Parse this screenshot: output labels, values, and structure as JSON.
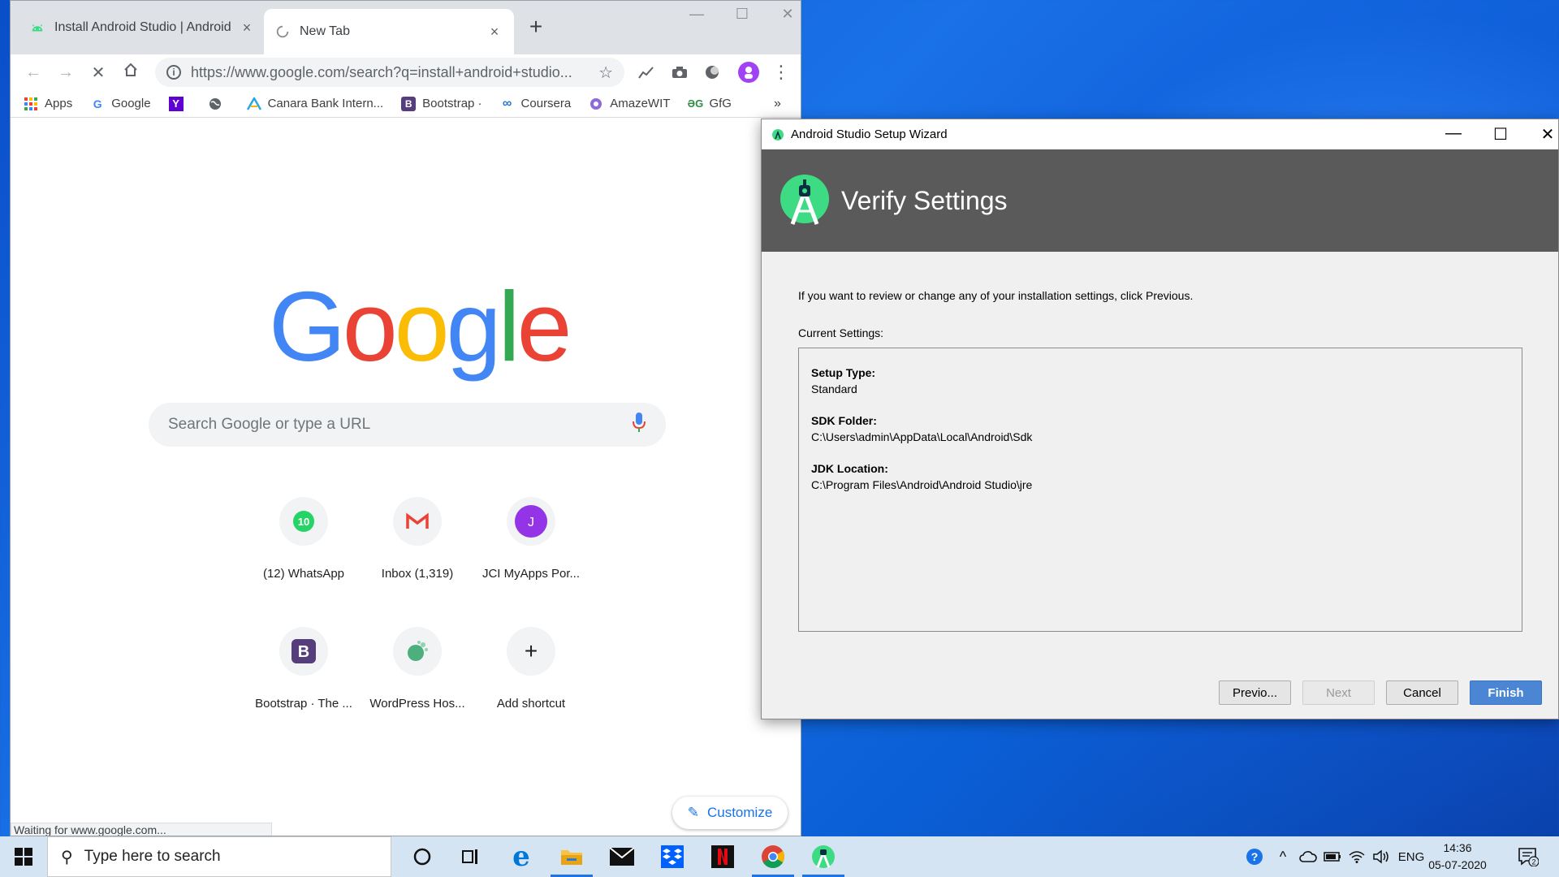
{
  "chrome": {
    "tabs": [
      {
        "title": "Install Android Studio  |  Android",
        "close": "×"
      },
      {
        "title": "New Tab",
        "close": "×"
      }
    ],
    "new_tab": "+",
    "window_controls": {
      "minimize": "—",
      "maximize": "☐",
      "close": "✕"
    },
    "url": "https://www.google.com/search?q=install+android+studio...",
    "bookmarks": [
      "Apps",
      "Google",
      "Canara Bank Intern...",
      "Bootstrap ·",
      "Coursera",
      "AmazeWIT",
      "GfG"
    ],
    "bookmarks_overflow": "»",
    "search_placeholder": "Search Google or type a URL",
    "shortcuts": [
      {
        "label": "(12) WhatsApp",
        "badge": "10"
      },
      {
        "label": "Inbox (1,319)",
        "badge": "M"
      },
      {
        "label": "JCI MyApps Por...",
        "badge": "J"
      },
      {
        "label": "Bootstrap · The ...",
        "badge": "B"
      },
      {
        "label": "WordPress Hos...",
        "badge": ""
      },
      {
        "label": "Add shortcut",
        "badge": "+"
      }
    ],
    "customize": "Customize",
    "status": "Waiting for www.google.com..."
  },
  "wizard": {
    "window_title": "Android Studio Setup Wizard",
    "heading": "Verify Settings",
    "intro": "If you want to review or change any of your installation settings, click Previous.",
    "current_settings_label": "Current Settings:",
    "settings": [
      {
        "key": "Setup Type:",
        "value": "Standard"
      },
      {
        "key": "SDK Folder:",
        "value": "C:\\Users\\admin\\AppData\\Local\\Android\\Sdk"
      },
      {
        "key": "JDK Location:",
        "value": "C:\\Program Files\\Android\\Android Studio\\jre"
      }
    ],
    "buttons": {
      "previous": "Previo...",
      "next": "Next",
      "cancel": "Cancel",
      "finish": "Finish"
    }
  },
  "taskbar": {
    "search_placeholder": "Type here to search",
    "language": "ENG",
    "time": "14:36",
    "date": "05-07-2020",
    "notifications": "2"
  },
  "colors": {
    "google_blue": "#4285f4",
    "google_red": "#ea4335",
    "google_yellow": "#fbbc05",
    "google_green": "#34a853",
    "android_green": "#3ddc84",
    "finish_blue": "#4a86d4"
  }
}
